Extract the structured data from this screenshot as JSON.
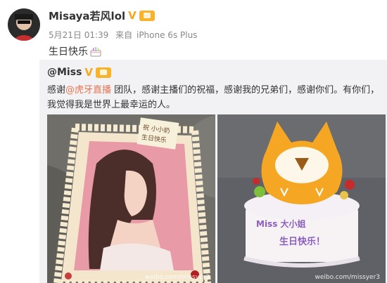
{
  "post": {
    "username": "Misaya若风lol",
    "date": "5月21日 01:39",
    "source_prefix": "来自",
    "source": "iPhone 6s Plus",
    "text": "生日快乐"
  },
  "repost": {
    "author": "@Miss",
    "text_before": "感谢",
    "mention": "@虎牙直播",
    "text_after": " 团队，感谢主播们的祝福，感谢我的兄弟们，感谢你们。有你们，我觉得我是世界上最幸运的人。",
    "images": [
      {
        "desc": "cake-photo-portrait",
        "watermark": "weibo.com/missyer3",
        "cake_note": "祝 小小奶 生日快乐"
      },
      {
        "desc": "cake-photo-huya",
        "watermark": "weibo.com/missyer3",
        "cake_text_line1": "Miss 大小姐",
        "cake_text_line2": "生日快乐！"
      }
    ]
  },
  "colors": {
    "mention": "#eb7350",
    "badge_v": "#f6a623",
    "repost_bg": "#f2f2f5"
  }
}
